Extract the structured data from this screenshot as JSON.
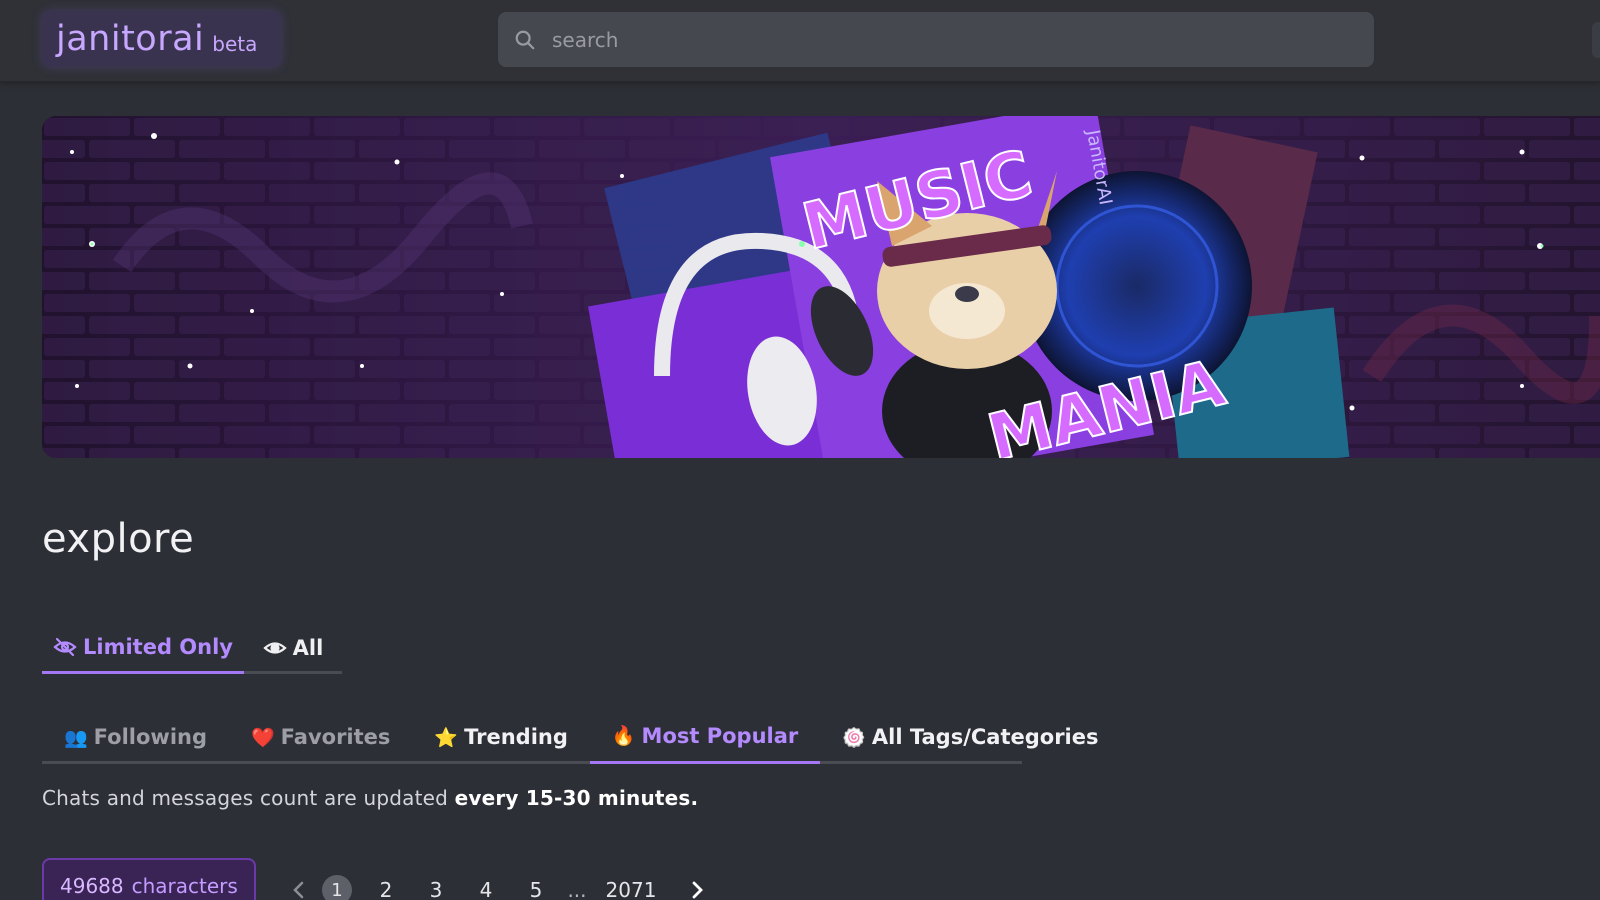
{
  "header": {
    "logo_text": "janitorai",
    "logo_badge": "beta",
    "search_placeholder": "search"
  },
  "banner": {
    "title_line1": "MUSIC",
    "title_line2": "MANIA",
    "watermark": "JanitorAI"
  },
  "page": {
    "title": "explore"
  },
  "visibility_tabs": [
    {
      "label": "Limited Only",
      "icon": "eye-slash-icon",
      "active": true
    },
    {
      "label": "All",
      "icon": "eye-icon",
      "active": false
    }
  ],
  "category_tabs": [
    {
      "emoji": "👥",
      "label": "Following",
      "active": false
    },
    {
      "emoji": "❤️",
      "label": "Favorites",
      "active": false
    },
    {
      "emoji": "⭐",
      "label": "Trending",
      "active": false
    },
    {
      "emoji": "🔥",
      "label": "Most Popular",
      "active": true
    },
    {
      "emoji": "🍥",
      "label": "All Tags/Categories",
      "active": false
    }
  ],
  "info": {
    "prefix": "Chats and messages count are updated ",
    "emphasis": "every 15-30 minutes."
  },
  "count": {
    "number": "49688",
    "label": "characters"
  },
  "pagination": {
    "pages": [
      "1",
      "2",
      "3",
      "4",
      "5"
    ],
    "ellipsis": "...",
    "last": "2071",
    "current": "1"
  },
  "colors": {
    "accent": "#b48aff",
    "background": "#2d2f36",
    "header": "#2f3137"
  }
}
